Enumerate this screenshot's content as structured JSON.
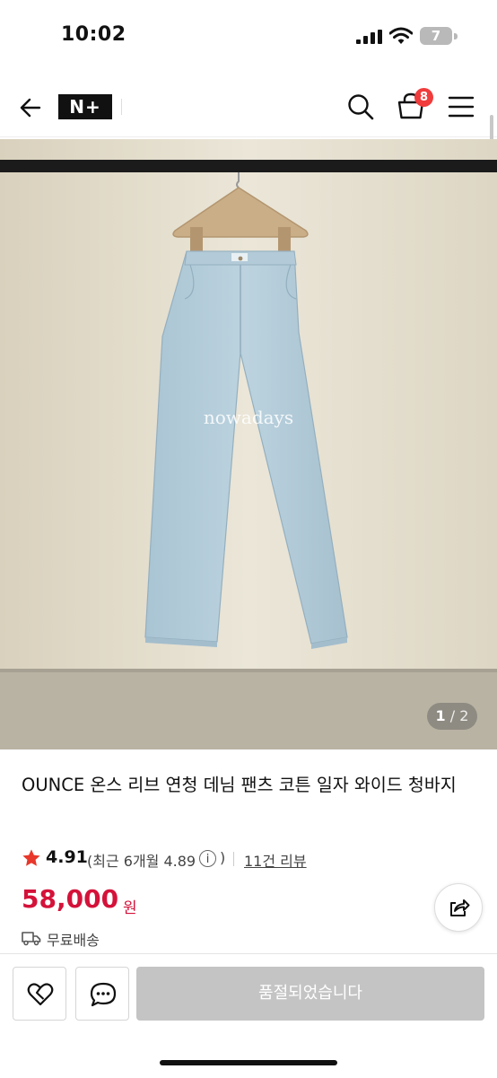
{
  "status_bar": {
    "time": "10:02",
    "battery": "7"
  },
  "header": {
    "logo": "N+",
    "cart_count": "8"
  },
  "product": {
    "image_watermark": "nowadays",
    "image_pager": {
      "current": "1",
      "separator": "/",
      "total": "2"
    },
    "title": "OUNCE 온스 리브 연청 데님 팬츠 코튼 일자 와이드 청바지",
    "rating": "4.91",
    "recent_rating_label": "(최근 6개월 4.89",
    "info_glyph": "i",
    "paren_close": ")",
    "reviews": "11건 리뷰",
    "price": "58,000",
    "currency": "원",
    "shipping": "무료배송"
  },
  "bottom_bar": {
    "soldout_label": "품절되었습니다"
  },
  "colors": {
    "price": "#d4123a",
    "badge": "#f03c3c",
    "star": "#e8372b",
    "disabled_button": "#c4c4c4"
  }
}
